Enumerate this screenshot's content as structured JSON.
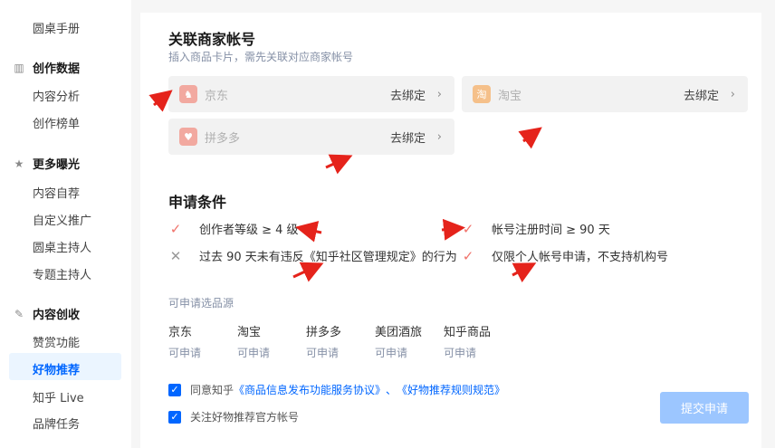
{
  "sidebar": {
    "top_item": "圆桌手册",
    "sections": [
      {
        "title": "创作数据",
        "icon": "bar-chart-icon",
        "items": [
          "内容分析",
          "创作榜单"
        ]
      },
      {
        "title": "更多曝光",
        "icon": "star-icon",
        "items": [
          "内容自荐",
          "自定义推广",
          "圆桌主持人",
          "专题主持人"
        ]
      },
      {
        "title": "内容创收",
        "icon": "pen-icon",
        "items": [
          "赞赏功能",
          "好物推荐",
          "知乎 Live",
          "品牌任务"
        ]
      }
    ],
    "active_item": "好物推荐"
  },
  "main": {
    "title": "关联商家帐号",
    "subtitle": "插入商品卡片，需先关联对应商家帐号",
    "merchants": [
      {
        "name": "京东",
        "action": "去绑定",
        "color": "#f2a9a0"
      },
      {
        "name": "淘宝",
        "action": "去绑定",
        "color": "#f5c08a"
      },
      {
        "name": "拼多多",
        "action": "去绑定",
        "color": "#f2a9a0"
      }
    ],
    "conditions_title": "申请条件",
    "conditions": [
      {
        "text": "创作者等级 ≥ 4 级",
        "met": true
      },
      {
        "text": "帐号注册时间 ≥ 90 天",
        "met": true
      },
      {
        "text": "过去 90 天未有违反《知乎社区管理规定》的行为",
        "met": false
      },
      {
        "text": "仅限个人帐号申请，不支持机构号",
        "met": true
      }
    ],
    "sources_label": "可申请选品源",
    "sources": [
      {
        "name": "京东",
        "status": "可申请"
      },
      {
        "name": "淘宝",
        "status": "可申请"
      },
      {
        "name": "拼多多",
        "status": "可申请"
      },
      {
        "name": "美团酒旅",
        "status": "可申请"
      },
      {
        "name": "知乎商品",
        "status": "可申请"
      }
    ],
    "agreement": {
      "prefix": "同意知乎",
      "link1": "《商品信息发布功能服务协议》",
      "sep": "、",
      "link2": "《好物推荐规则规范》",
      "checked": true
    },
    "follow": {
      "text": "关注好物推荐官方帐号",
      "checked": true
    },
    "submit_label": "提交申请"
  },
  "colors": {
    "accent": "#0066ff",
    "check": "#f0736b",
    "annotation": "#e5231b"
  }
}
